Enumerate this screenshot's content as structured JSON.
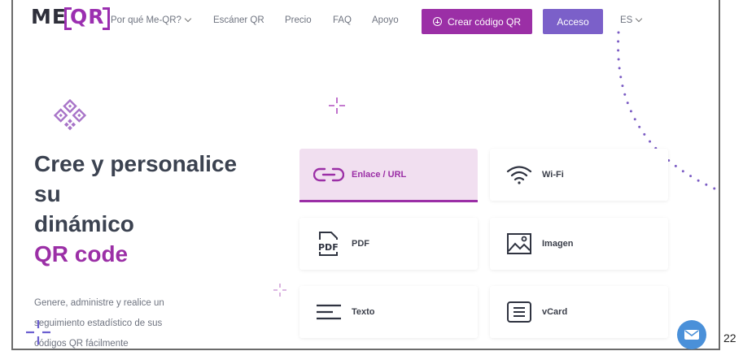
{
  "nav": {
    "logo_me": "ME",
    "logo_qr": "QR",
    "items": [
      {
        "label": "Por qué Me-QR?",
        "has_dropdown": true
      },
      {
        "label": "Escáner QR",
        "has_dropdown": false
      },
      {
        "label": "Precio",
        "has_dropdown": false
      },
      {
        "label": "FAQ",
        "has_dropdown": false
      },
      {
        "label": "Apoyo",
        "has_dropdown": false
      }
    ],
    "create_button": "Crear código QR",
    "login_button": "Acceso",
    "language": "ES"
  },
  "hero": {
    "line1": "Cree y personalice",
    "line2": "su",
    "line3": "dinámico",
    "line4": "QR code",
    "subtitle_lines": [
      "Genere, administre y realice un",
      "seguimiento estadístico de sus",
      "códigos QR fácilmente"
    ]
  },
  "cards": [
    {
      "label": "Enlace / URL",
      "icon": "link-icon",
      "active": true
    },
    {
      "label": "Wi-Fi",
      "icon": "wifi-icon",
      "active": false
    },
    {
      "label": "PDF",
      "icon": "pdf-icon",
      "active": false
    },
    {
      "label": "Imagen",
      "icon": "image-icon",
      "active": false
    },
    {
      "label": "Texto",
      "icon": "text-icon",
      "active": false
    },
    {
      "label": "vCard",
      "icon": "vcard-icon",
      "active": false
    }
  ],
  "page_number": "22",
  "colors": {
    "brand_purple": "#9b2fa6",
    "login_purple": "#7b60c9",
    "heading": "#3b4250",
    "active_card_bg": "#f1dff0",
    "chat_blue": "#4a90d9"
  }
}
